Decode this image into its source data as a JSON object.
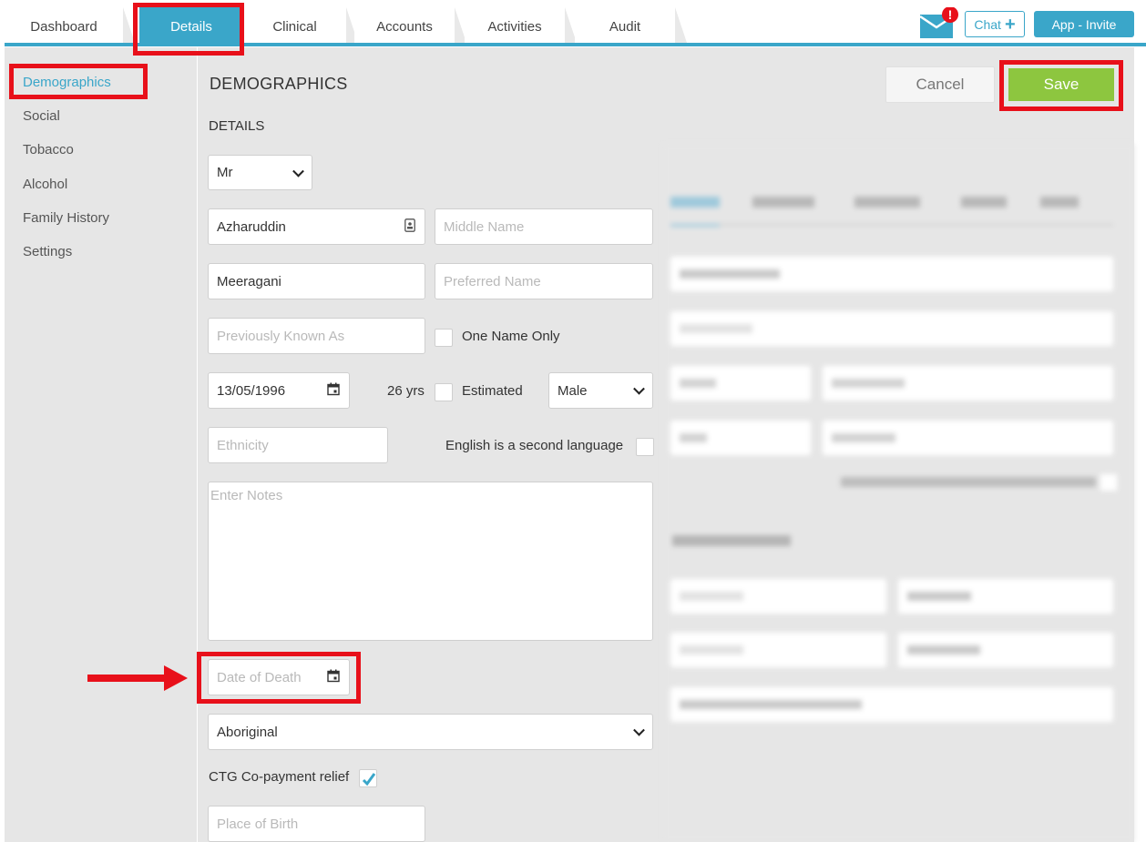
{
  "tabs": [
    {
      "label": "Dashboard"
    },
    {
      "label": "Details"
    },
    {
      "label": "Clinical"
    },
    {
      "label": "Accounts"
    },
    {
      "label": "Activities"
    },
    {
      "label": "Audit"
    }
  ],
  "header": {
    "mail_alert_badge": "!",
    "chat_label": "Chat",
    "app_invite_label": "App - Invite"
  },
  "sidebar": {
    "items": [
      {
        "label": "Demographics"
      },
      {
        "label": "Social"
      },
      {
        "label": "Tobacco"
      },
      {
        "label": "Alcohol"
      },
      {
        "label": "Family History"
      },
      {
        "label": "Settings"
      }
    ]
  },
  "main": {
    "heading": "DEMOGRAPHICS",
    "section": "DETAILS",
    "cancel_label": "Cancel",
    "save_label": "Save"
  },
  "form": {
    "title": "Mr",
    "first_name": "Azharuddin",
    "middle_name_placeholder": "Middle Name",
    "last_name": "Meeragani",
    "preferred_name_placeholder": "Preferred Name",
    "previously_known_placeholder": "Previously Known As",
    "one_name_only_label": "One Name Only",
    "dob": "13/05/1996",
    "age": "26 yrs",
    "estimated_label": "Estimated",
    "sex": "Male",
    "ethnicity_placeholder": "Ethnicity",
    "english_second_label": "English is a second language",
    "notes_placeholder": "Enter Notes",
    "date_of_death_placeholder": "Date of Death",
    "indigenous_status": "Aboriginal",
    "ctg_label": "CTG Co-payment relief",
    "ctg_checked": true,
    "place_of_birth_placeholder": "Place of Birth"
  },
  "colors": {
    "accent": "#3aa6c9",
    "save": "#8dc63f",
    "annotation": "#e8101a"
  }
}
